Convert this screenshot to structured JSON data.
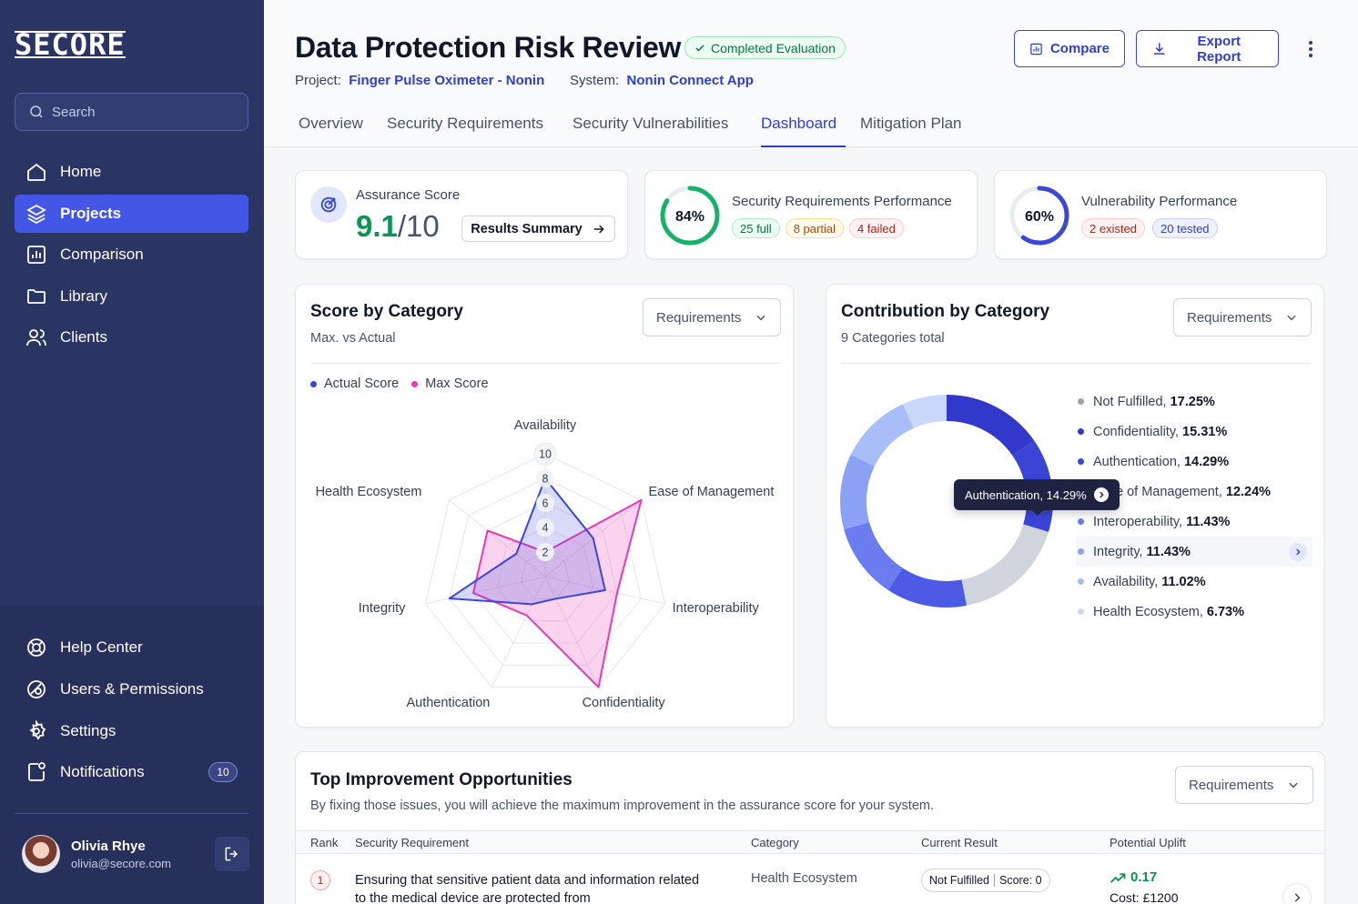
{
  "sidebar": {
    "logo": "SECORE",
    "search_placeholder": "Search",
    "nav": [
      {
        "label": "Home",
        "icon": "home-icon"
      },
      {
        "label": "Projects",
        "icon": "layers-icon",
        "active": true
      },
      {
        "label": "Comparison",
        "icon": "bar-chart-icon"
      },
      {
        "label": "Library",
        "icon": "folder-icon"
      },
      {
        "label": "Clients",
        "icon": "users-icon"
      }
    ],
    "bottom_nav": [
      {
        "label": "Help Center",
        "icon": "lifebuoy-icon"
      },
      {
        "label": "Users & Permissions",
        "icon": "permissions-icon"
      },
      {
        "label": "Settings",
        "icon": "gear-icon"
      },
      {
        "label": "Notifications",
        "icon": "bell-icon",
        "count": "10"
      }
    ],
    "user": {
      "name": "Olivia Rhye",
      "email": "olivia@secore.com"
    }
  },
  "header": {
    "title": "Data Protection Risk Review",
    "status": "Completed Evaluation",
    "project_label": "Project:",
    "project_value": "Finger Pulse Oximeter - Nonin",
    "system_label": "System:",
    "system_value": "Nonin Connect App",
    "compare_label": "Compare",
    "export_label": "Export Report",
    "tabs": [
      "Overview",
      "Security Requirements",
      "Security Vulnerabilities",
      "Dashboard",
      "Mitigation Plan"
    ],
    "active_tab": "Dashboard"
  },
  "kpis": {
    "assurance": {
      "label": "Assurance Score",
      "score": "9.1",
      "max": "/10",
      "button": "Results Summary"
    },
    "requirements": {
      "label": "Security Requirements Performance",
      "percent_text": "84%",
      "percent": 84,
      "full": "25 full",
      "partial": "8 partial",
      "failed": "4 failed"
    },
    "vulnerability": {
      "label": "Vulnerability Performance",
      "percent_text": "60%",
      "percent": 60,
      "existed": "2 existed",
      "tested": "20 tested"
    }
  },
  "score_card": {
    "title": "Score by Category",
    "subtitle": "Max. vs Actual",
    "dropdown": "Requirements",
    "legend": {
      "actual": "Actual Score",
      "max": "Max Score"
    },
    "ticks": [
      "2",
      "4",
      "6",
      "8",
      "10"
    ]
  },
  "contribution_card": {
    "title": "Contribution by Category",
    "subtitle": "9 Categories total",
    "dropdown": "Requirements",
    "tooltip": "Authentication, 14.29%"
  },
  "chart_data": [
    {
      "type": "radar",
      "axes": [
        "Availability",
        "Ease of Management",
        "Interoperability",
        "Confidentiality",
        "Authentication",
        "Integrity",
        "Health Ecosystem"
      ],
      "rmax": 10,
      "series": [
        {
          "name": "Actual Score",
          "color": "#3b47d6",
          "values": [
            8,
            5,
            5,
            2,
            2.5,
            8,
            3
          ]
        },
        {
          "name": "Max Score",
          "color": "#e83ab6",
          "values": [
            2,
            10,
            6,
            10,
            3.5,
            6,
            6
          ]
        }
      ]
    },
    {
      "type": "pie",
      "donut": true,
      "slices": [
        {
          "label": "Not Fulfilled",
          "value": 17.25,
          "value_text": "17.25%",
          "color": "#9ca3af"
        },
        {
          "label": "Confidentiality",
          "value": 15.31,
          "value_text": "15.31%",
          "color": "#3238c9"
        },
        {
          "label": "Authentication",
          "value": 14.29,
          "value_text": "14.29%",
          "color": "#3a45d8"
        },
        {
          "label": "Ease of Management",
          "value": 12.24,
          "value_text": "12.24%",
          "color": "#4c5ae6"
        },
        {
          "label": "Interoperability",
          "value": 11.43,
          "value_text": "11.43%",
          "color": "#6b7cf0"
        },
        {
          "label": "Integrity",
          "value": 11.43,
          "value_text": "11.43%",
          "color": "#8ba1f5"
        },
        {
          "label": "Availability",
          "value": 11.02,
          "value_text": "11.02%",
          "color": "#a9bdf8"
        },
        {
          "label": "Health Ecosystem",
          "value": 6.73,
          "value_text": "6.73%",
          "color": "#c9d7fb"
        }
      ]
    }
  ],
  "improvements": {
    "title": "Top Improvement Opportunities",
    "subtitle": "By fixing those issues, you will achieve the maximum improvement in the assurance score for your system.",
    "dropdown": "Requirements",
    "columns": [
      "Rank",
      "Security Requirement",
      "Category",
      "Current Result",
      "Potential Uplift"
    ],
    "rows": [
      {
        "rank": "1",
        "requirement": "Ensuring that sensitive patient data and information related to the medical device are protected from",
        "category": "Health Ecosystem",
        "result": "Not Fulfilled",
        "score": "Score: 0",
        "uplift": "0.17",
        "cost": "Cost: £1200"
      }
    ]
  }
}
